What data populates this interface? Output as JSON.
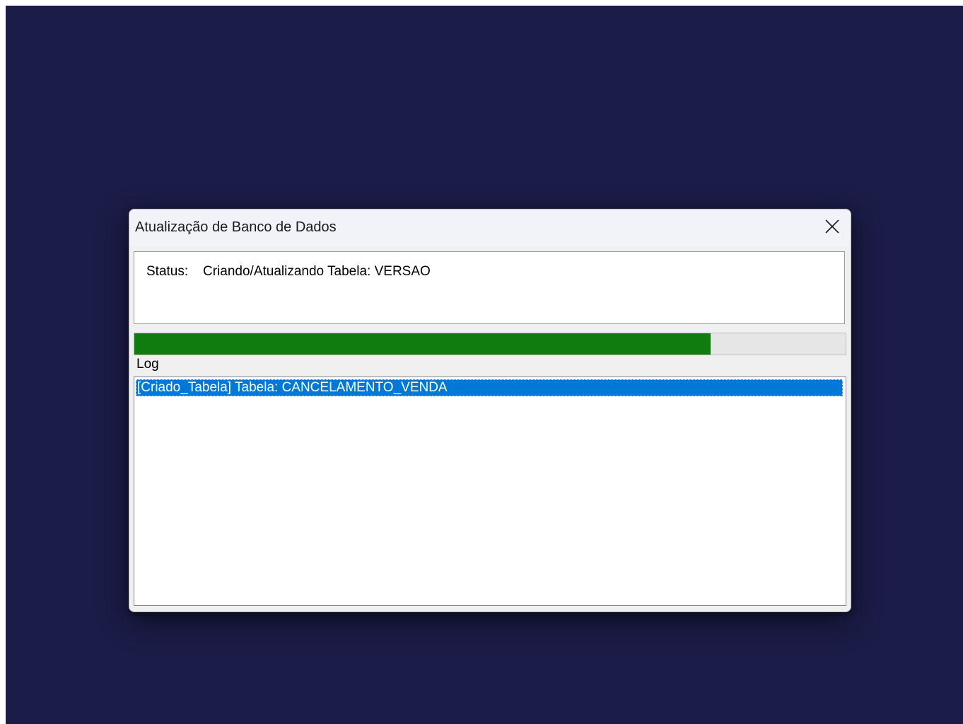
{
  "window": {
    "title": "Atualização de Banco de Dados",
    "close_icon": "close-icon"
  },
  "status": {
    "label": "Status:",
    "value": "Criando/Atualizando Tabela: VERSAO"
  },
  "progress": {
    "percent": 81,
    "color": "#107c10"
  },
  "log": {
    "label": "Log",
    "items": [
      {
        "text": "[Criado_Tabela] Tabela: CANCELAMENTO_VENDA",
        "selected": true
      }
    ]
  },
  "colors": {
    "desktop_background": "#1b1c47",
    "selection": "#0078d7"
  }
}
